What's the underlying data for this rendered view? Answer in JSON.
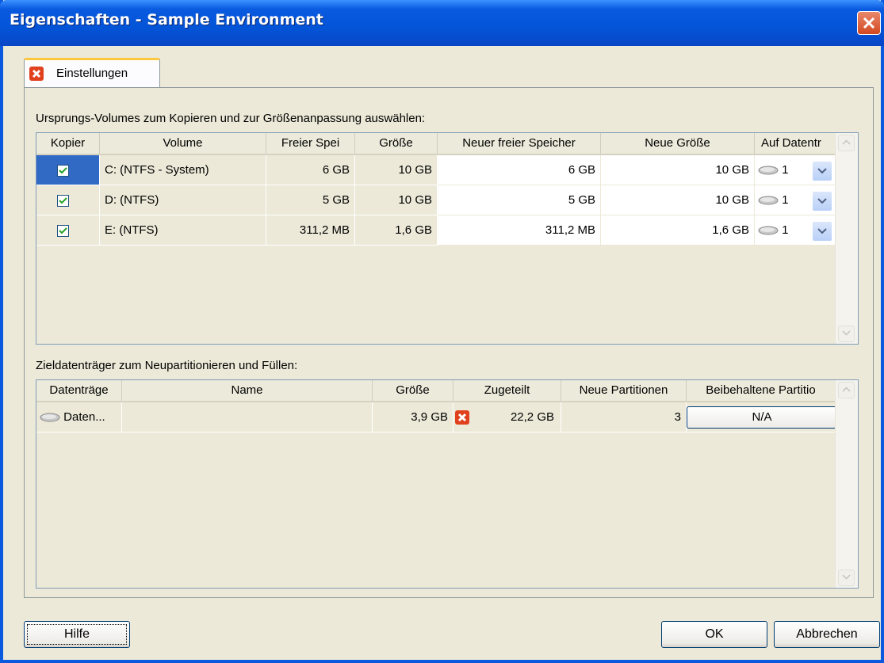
{
  "window": {
    "title": "Eigenschaften - Sample Environment"
  },
  "tab": {
    "label": "Einstellungen",
    "icon": "error-icon"
  },
  "source": {
    "label": "Ursprungs-Volumes zum Kopieren und zur Größenanpassung auswählen:",
    "columns": [
      "Kopier",
      "Volume",
      "Freier Spei",
      "Größe",
      "Neuer freier Speicher",
      "Neue Größe",
      "Auf Datentr"
    ],
    "rows": [
      {
        "checked": true,
        "volume": "C: (NTFS - System)",
        "free": "6 GB",
        "size": "10 GB",
        "new_free": "6 GB",
        "new_size": "10 GB",
        "disk": "1"
      },
      {
        "checked": true,
        "volume": "D: (NTFS)",
        "free": "5 GB",
        "size": "10 GB",
        "new_free": "5 GB",
        "new_size": "10 GB",
        "disk": "1"
      },
      {
        "checked": true,
        "volume": "E: (NTFS)",
        "free": "311,2 MB",
        "size": "1,6 GB",
        "new_free": "311,2 MB",
        "new_size": "1,6 GB",
        "disk": "1"
      }
    ]
  },
  "target": {
    "label": "Zieldatenträger zum Neupartitionieren und Füllen:",
    "columns": [
      "Datenträge",
      "Name",
      "Größe",
      "Zugeteilt",
      "Neue Partitionen",
      "Beibehaltene Partitio"
    ],
    "rows": [
      {
        "disk": "Daten...",
        "name": "",
        "size": "3,9 GB",
        "allocated": "22,2 GB",
        "new_partitions": "3",
        "kept": "N/A"
      }
    ]
  },
  "buttons": {
    "help": "Hilfe",
    "ok": "OK",
    "cancel": "Abbrechen"
  },
  "colors": {
    "titlebar": "#0a5ae0",
    "selection": "#316ac5",
    "error": "#e0401c",
    "face": "#ece9d8"
  }
}
